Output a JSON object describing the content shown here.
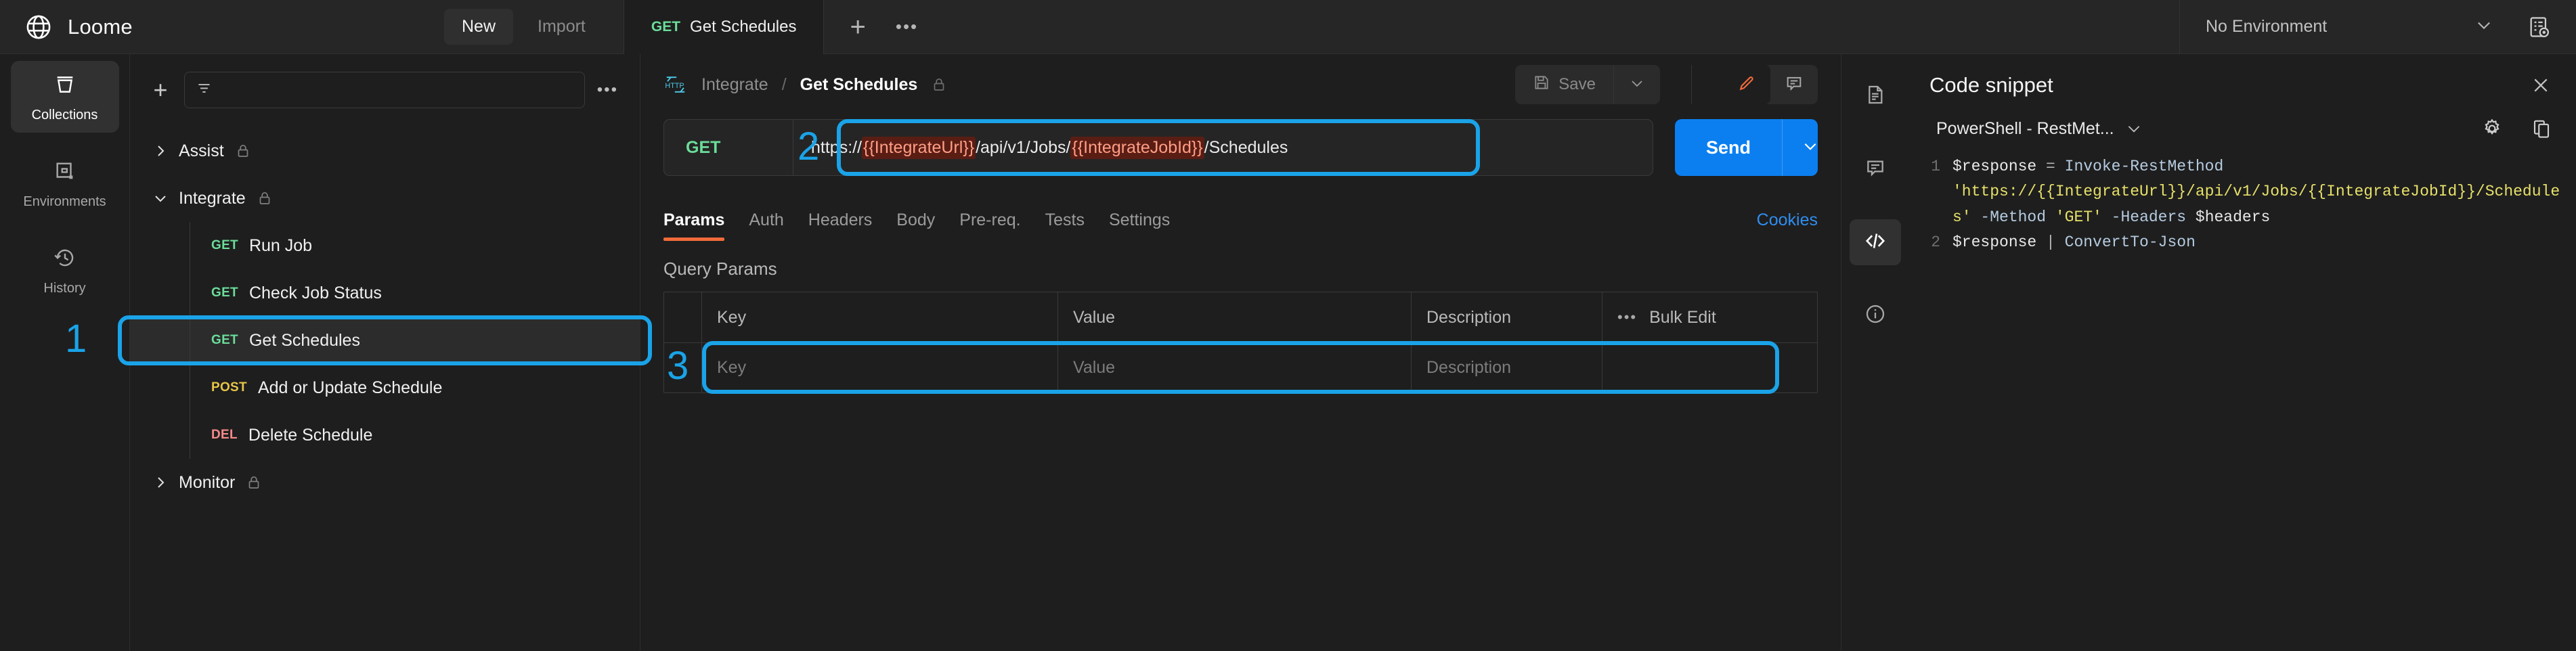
{
  "app": {
    "brand": "Loome"
  },
  "topbar": {
    "new_label": "New",
    "import_label": "Import",
    "tab": {
      "method": "GET",
      "title": "Get Schedules"
    },
    "add_tab_icon": "plus-icon",
    "tab_more_icon": "more-horizontal-icon",
    "environment": {
      "label": "No Environment",
      "caret_icon": "chevron-down-icon"
    },
    "env_quick_look_icon": "environment-quick-look-icon"
  },
  "rail": {
    "items": [
      {
        "label": "Collections",
        "icon": "collections-icon",
        "active": true
      },
      {
        "label": "Environments",
        "icon": "environments-icon",
        "active": false
      },
      {
        "label": "History",
        "icon": "history-icon",
        "active": false
      }
    ]
  },
  "tree": {
    "add_icon": "plus-icon",
    "filter_placeholder": "",
    "filter_value": "",
    "filter_icon": "filter-icon",
    "more_icon": "more-horizontal-icon",
    "groups": [
      {
        "label": "Assist",
        "expanded": false,
        "locked": true,
        "chevron": "chevron-right-icon"
      },
      {
        "label": "Integrate",
        "expanded": true,
        "locked": true,
        "chevron": "chevron-down-icon"
      },
      {
        "label": "Monitor",
        "expanded": false,
        "locked": true,
        "chevron": "chevron-right-icon"
      }
    ],
    "integrate_requests": [
      {
        "method": "GET",
        "name": "Run Job",
        "selected": false
      },
      {
        "method": "GET",
        "name": "Check Job Status",
        "selected": false
      },
      {
        "method": "GET",
        "name": "Get Schedules",
        "selected": true
      },
      {
        "method": "POST",
        "name": "Add or Update Schedule",
        "selected": false
      },
      {
        "method": "DEL",
        "name": "Delete Schedule",
        "selected": false
      }
    ]
  },
  "request": {
    "breadcrumb": {
      "http_icon": "http-icon",
      "collection": "Integrate",
      "separator": "/",
      "name": "Get Schedules",
      "lock_icon": "lock-icon"
    },
    "save_label": "Save",
    "save_icon": "save-disk-icon",
    "save_caret_icon": "chevron-down-icon",
    "edit_icon": "pencil-icon",
    "comment_icon": "comment-icon",
    "method": "GET",
    "url": {
      "full": "https://{{IntegrateUrl}}/api/v1/Jobs/{{IntegrateJobId}}/Schedules",
      "parts": [
        {
          "text": "https://",
          "variable": false
        },
        {
          "text": "{{IntegrateUrl}}",
          "variable": true
        },
        {
          "text": "/api/v1/Jobs/",
          "variable": false
        },
        {
          "text": "{{IntegrateJobId}}",
          "variable": true
        },
        {
          "text": "/Schedules",
          "variable": false
        }
      ]
    },
    "send_label": "Send",
    "send_caret_icon": "chevron-down-icon",
    "tabs": [
      {
        "label": "Params",
        "active": true
      },
      {
        "label": "Auth",
        "active": false
      },
      {
        "label": "Headers",
        "active": false
      },
      {
        "label": "Body",
        "active": false
      },
      {
        "label": "Pre-req.",
        "active": false
      },
      {
        "label": "Tests",
        "active": false
      },
      {
        "label": "Settings",
        "active": false
      }
    ],
    "cookies_label": "Cookies",
    "query_params_title": "Query Params",
    "table": {
      "headers": {
        "key": "Key",
        "value": "Value",
        "description": "Description"
      },
      "bulk_dots_icon": "more-horizontal-icon",
      "bulk_edit_label": "Bulk Edit",
      "rows": [
        {
          "key_placeholder": "Key",
          "value_placeholder": "Value",
          "description_placeholder": "Description"
        }
      ]
    }
  },
  "right_panel": {
    "rail": [
      {
        "icon": "documentation-icon",
        "active": false
      },
      {
        "icon": "comment-icon",
        "active": false
      },
      {
        "icon": "code-icon",
        "active": true
      },
      {
        "icon": "info-icon",
        "active": false
      }
    ],
    "title": "Code snippet",
    "title_icon": "documentation-icon",
    "close_icon": "close-icon",
    "language": "PowerShell - RestMet...",
    "language_caret_icon": "chevron-down-icon",
    "settings_icon": "gear-icon",
    "copy_icon": "copy-icon",
    "code": {
      "language": "powershell",
      "lines": [
        {
          "number": "1",
          "tokens": [
            {
              "t": "$response ",
              "c": "var"
            },
            {
              "t": "= ",
              "c": "op"
            },
            {
              "t": "Invoke-RestMethod ",
              "c": "fn"
            },
            {
              "t": "'https://{{IntegrateUrl}}/api/v1/Jobs/{{IntegrateJobId}}/Schedules'",
              "c": "str"
            },
            {
              "t": " -Method ",
              "c": "par"
            },
            {
              "t": "'GET'",
              "c": "str"
            },
            {
              "t": " -Headers ",
              "c": "par"
            },
            {
              "t": "$headers",
              "c": "var"
            }
          ]
        },
        {
          "number": "2",
          "tokens": [
            {
              "t": "$response ",
              "c": "var"
            },
            {
              "t": "| ",
              "c": "op"
            },
            {
              "t": "ConvertTo-Json",
              "c": "fn"
            }
          ]
        }
      ]
    }
  },
  "annotations": [
    {
      "number": "1",
      "target": "sidebar-get-schedules"
    },
    {
      "number": "2",
      "target": "url-input"
    },
    {
      "number": "3",
      "target": "query-param-key-value-row"
    }
  ],
  "colors": {
    "accent_blue": "#0b7ff0",
    "annotation_blue": "#1aa3e8",
    "active_tab_orange": "#f26b3a",
    "method_get_green": "#6bdd9a",
    "method_post_yellow": "#e8c547",
    "method_delete_red": "#f58a8a",
    "variable_highlight_bg": "#5a1d14",
    "variable_highlight_text": "#ff9e86",
    "panel_bg": "#1e1e1e",
    "topbar_bg": "#262626"
  }
}
